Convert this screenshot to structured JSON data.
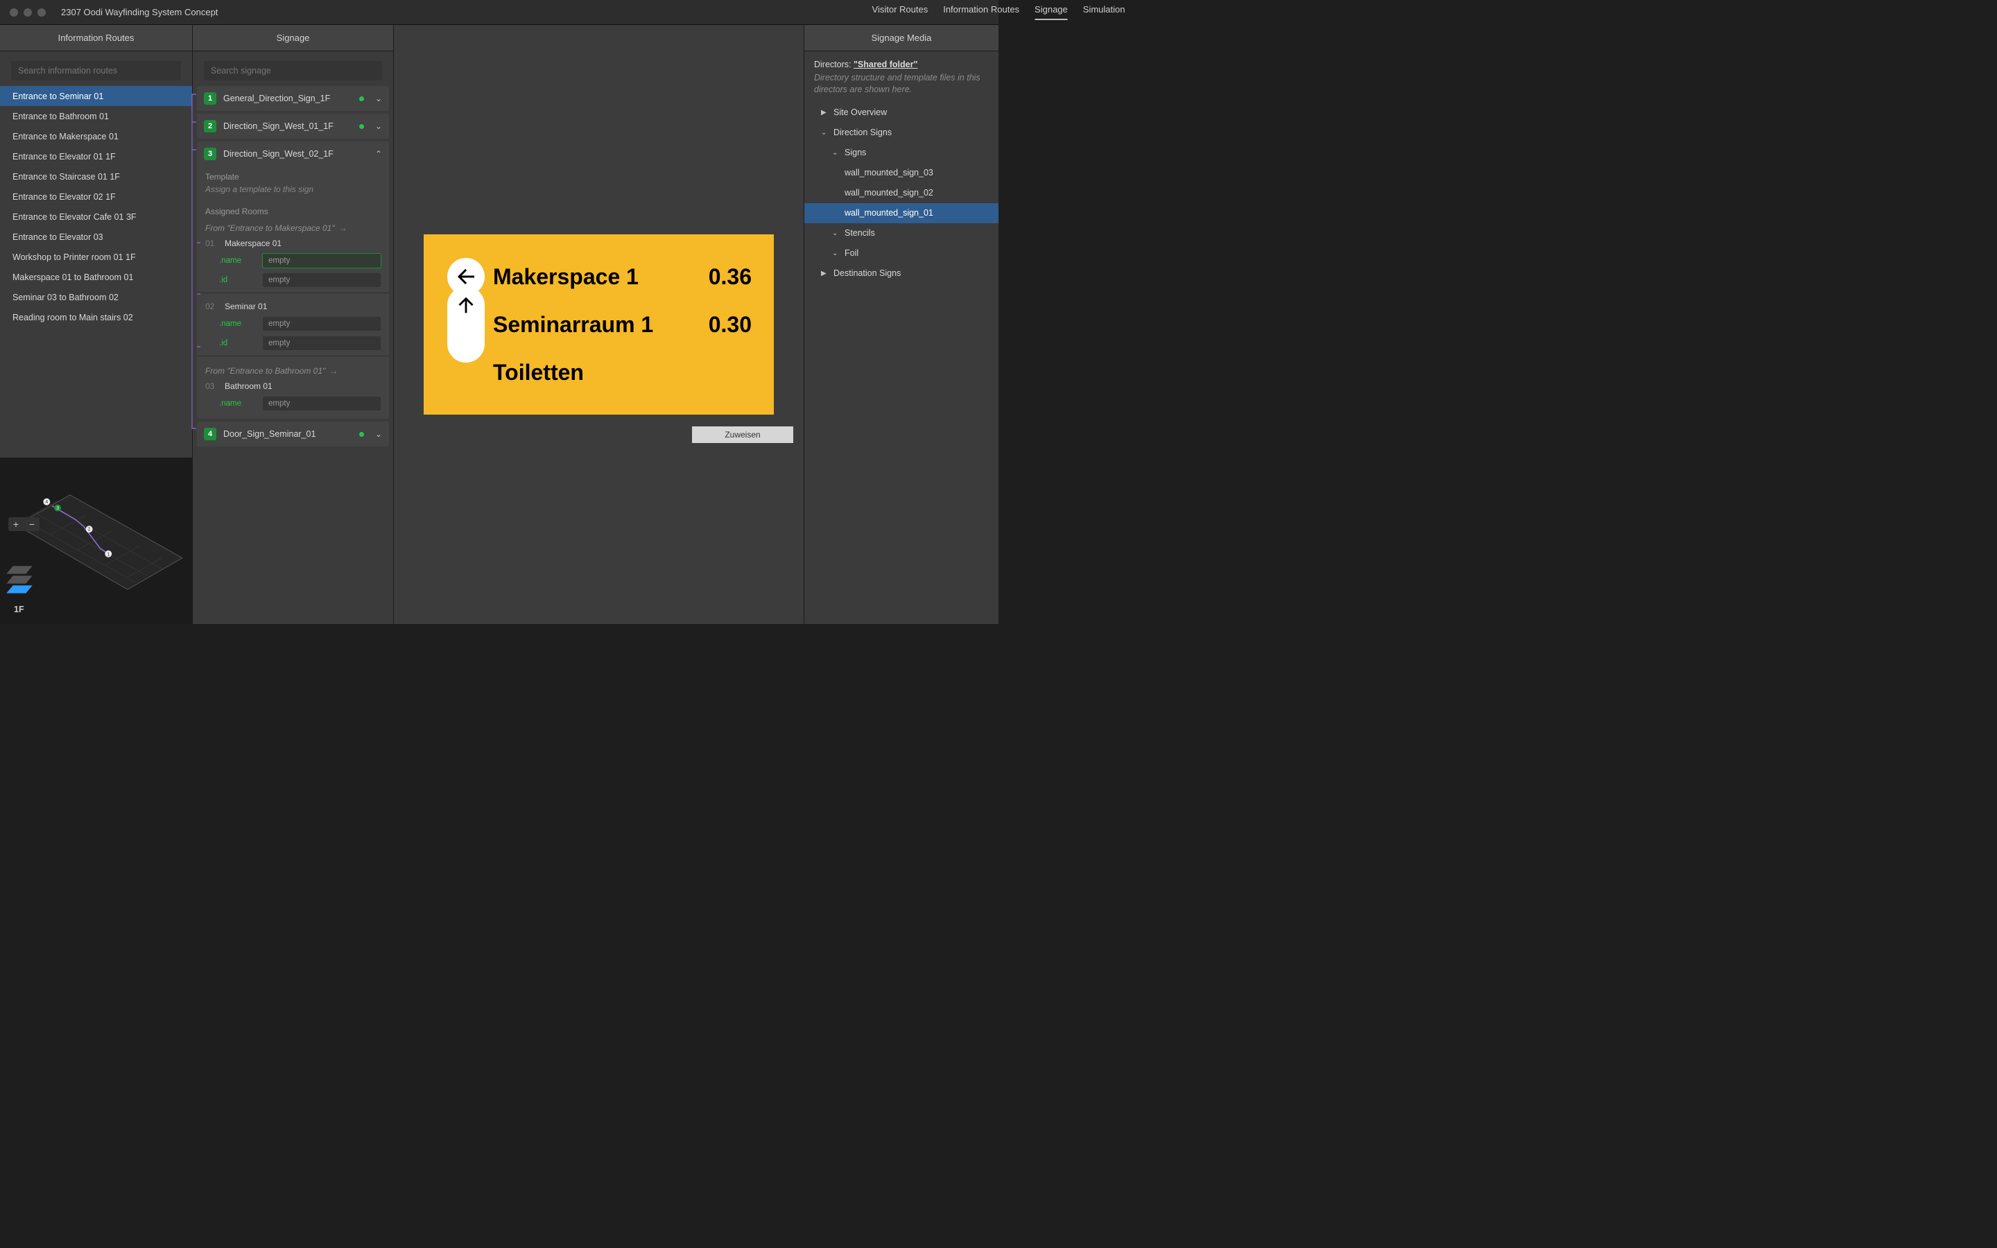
{
  "window": {
    "title": "2307 Oodi Wayfinding System Concept"
  },
  "tabs": [
    {
      "label": "Visitor Routes",
      "active": false
    },
    {
      "label": "Information Routes",
      "active": false
    },
    {
      "label": "Signage",
      "active": true
    },
    {
      "label": "Simulation",
      "active": false
    }
  ],
  "routes": {
    "header": "Information Routes",
    "search_placeholder": "Search information routes",
    "items": [
      {
        "label": "Entrance to Seminar 01",
        "selected": true
      },
      {
        "label": "Entrance to Bathroom 01"
      },
      {
        "label": "Entrance to Makerspace 01"
      },
      {
        "label": "Entrance to Elevator 01 1F"
      },
      {
        "label": "Entrance to Staircase 01 1F"
      },
      {
        "label": "Entrance to Elevator 02 1F"
      },
      {
        "label": "Entrance to Elevator Cafe 01 3F"
      },
      {
        "label": "Entrance to Elevator 03"
      },
      {
        "label": "Workshop to Printer room 01 1F"
      },
      {
        "label": "Makerspace 01 to Bathroom 01"
      },
      {
        "label": "Seminar 03 to Bathroom 02"
      },
      {
        "label": "Reading room to Main stairs 02"
      }
    ],
    "floor_label": "1F"
  },
  "signage": {
    "header": "Signage",
    "search_placeholder": "Search signage",
    "cards": [
      {
        "num": "1",
        "name": "General_Direction_Sign_1F",
        "status": "ok",
        "expanded": false
      },
      {
        "num": "2",
        "name": "Direction_Sign_West_01_1F",
        "status": "ok",
        "expanded": false
      },
      {
        "num": "3",
        "name": "Direction_Sign_West_02_1F",
        "expanded": true,
        "template_header": "Template",
        "template_hint": "Assign a template to this sign",
        "assigned_header": "Assigned Rooms",
        "groups": [
          {
            "from": "From \"Entrance to Makerspace 01\"",
            "rooms": [
              {
                "id": "01",
                "name": "Makerspace 01",
                "props": [
                  {
                    "key": ".name",
                    "value": "empty",
                    "highlight": true
                  },
                  {
                    "key": ".id",
                    "value": "empty"
                  }
                ]
              }
            ]
          },
          {
            "from": null,
            "rooms": [
              {
                "id": "02",
                "name": "Seminar 01",
                "props": [
                  {
                    "key": ".name",
                    "value": "empty"
                  },
                  {
                    "key": ".id",
                    "value": "empty"
                  }
                ]
              }
            ]
          },
          {
            "from": "From \"Entrance to Bathroom 01\"",
            "rooms": [
              {
                "id": "03",
                "name": "Bathroom 01",
                "props": [
                  {
                    "key": ".name",
                    "value": "empty"
                  }
                ]
              }
            ]
          }
        ]
      },
      {
        "num": "4",
        "name": "Door_Sign_Seminar_01",
        "status": "ok",
        "expanded": false
      }
    ]
  },
  "preview": {
    "rows": [
      {
        "icon": "arrow-left",
        "text": "Makerspace 1",
        "num": "0.36",
        "highlight": true
      },
      {
        "icon": "arrow-up",
        "text": "Seminarraum 1",
        "num": "0.30"
      },
      {
        "icon": "pill",
        "text": "Toiletten"
      }
    ],
    "assign_button": "Zuweisen"
  },
  "media": {
    "header": "Signage Media",
    "directors_label": "Directors:",
    "directors_link": "\"Shared folder\"",
    "subtext": "Directory structure and template files in this directors are shown here.",
    "tree": [
      {
        "label": "Site Overview",
        "indent": 0,
        "expandable": true,
        "open": false,
        "icon": "right"
      },
      {
        "label": "Direction Signs",
        "indent": 0,
        "expandable": true,
        "open": true,
        "icon": "down"
      },
      {
        "label": "Signs",
        "indent": 1,
        "expandable": true,
        "open": true,
        "icon": "down"
      },
      {
        "label": "wall_mounted_sign_03",
        "indent": 2,
        "leaf": true
      },
      {
        "label": "wall_mounted_sign_02",
        "indent": 2,
        "leaf": true
      },
      {
        "label": "wall_mounted_sign_01",
        "indent": 2,
        "leaf": true,
        "selected": true
      },
      {
        "label": "Stencils",
        "indent": 1,
        "expandable": true,
        "open": true,
        "icon": "down"
      },
      {
        "label": "Foil",
        "indent": 1,
        "expandable": true,
        "open": true,
        "icon": "down"
      },
      {
        "label": "Destination Signs",
        "indent": 0,
        "expandable": true,
        "open": false,
        "icon": "right"
      }
    ]
  }
}
